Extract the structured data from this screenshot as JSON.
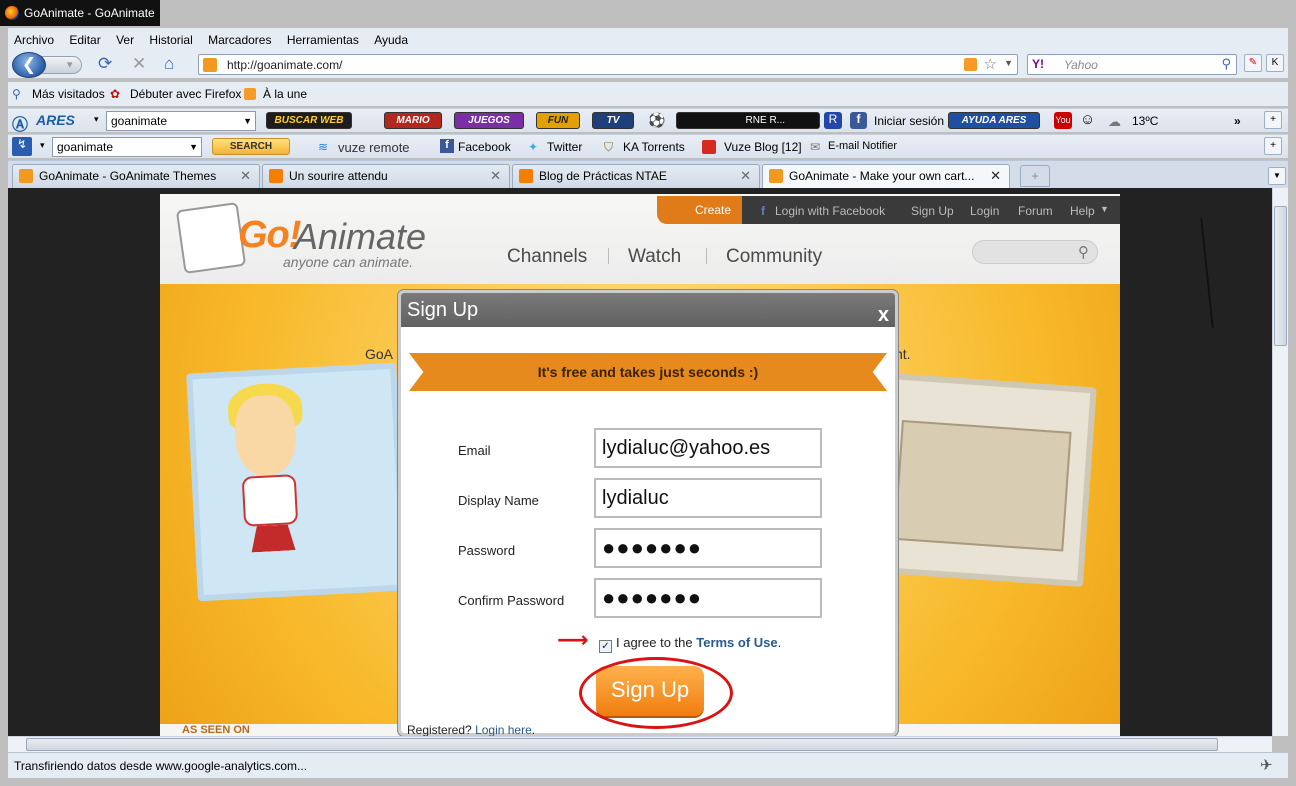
{
  "window": {
    "title": "GoAnimate - GoAnimate"
  },
  "menu": [
    "Archivo",
    "Editar",
    "Ver",
    "Historial",
    "Marcadores",
    "Herramientas",
    "Ayuda"
  ],
  "nav": {
    "back": "❮",
    "forward": "▾",
    "url": "http://goanimate.com/",
    "search_placeholder": "Yahoo",
    "search_engine": "Y!"
  },
  "bookmarks": [
    "Más visitados",
    "Débuter avec Firefox",
    "À la une"
  ],
  "ares_toolbar": {
    "brand": "ARES",
    "query": "goanimate",
    "buttons": [
      "BUSCAR WEB",
      "MARIO",
      "JUEGOS",
      "FUN",
      "TV"
    ],
    "radio": "RNE R...",
    "login": "Iniciar sesión",
    "help": "AYUDA ARES",
    "weather": "13ºC"
  },
  "vuze_toolbar": {
    "query": "goanimate",
    "search": "SEARCH",
    "items": [
      "vuze remote",
      "Facebook",
      "Twitter",
      "KA Torrents",
      "Vuze Blog [12]",
      "E-mail Notifier"
    ]
  },
  "tabs": [
    {
      "label": "GoAnimate - GoAnimate Themes"
    },
    {
      "label": "Un sourire attendu"
    },
    {
      "label": "Blog de Prácticas NTAE"
    },
    {
      "label": "GoAnimate - Make your own cart..."
    }
  ],
  "site": {
    "logo_go": "Go!",
    "logo_animate": "Animate",
    "tagline": "anyone can animate.",
    "topnav": {
      "create": "Create",
      "facebook": "Login with Facebook",
      "signup": "Sign Up",
      "login": "Login",
      "forum": "Forum",
      "help": "Help"
    },
    "mainnav": [
      "Channels",
      "Watch",
      "Community"
    ],
    "bg_left": "GoA",
    "bg_right": "nt.",
    "seen_on": "AS SEEN ON"
  },
  "dialog": {
    "title": "Sign Up",
    "close": "x",
    "ribbon": "It's free and takes just seconds :)",
    "fields": [
      {
        "label": "Email",
        "value": "lydialuc@yahoo.es"
      },
      {
        "label": "Display Name",
        "value": "lydialuc"
      },
      {
        "label": "Password",
        "value": "●●●●●●●"
      },
      {
        "label": "Confirm Password",
        "value": "●●●●●●●"
      }
    ],
    "agree_prefix": "I agree to the ",
    "terms": "Terms of Use",
    "agree_suffix": ".",
    "submit": "Sign Up",
    "registered": "Registered?",
    "login_here": "Login here"
  },
  "status": {
    "text": "Transfiriendo datos desde www.google-analytics.com..."
  }
}
